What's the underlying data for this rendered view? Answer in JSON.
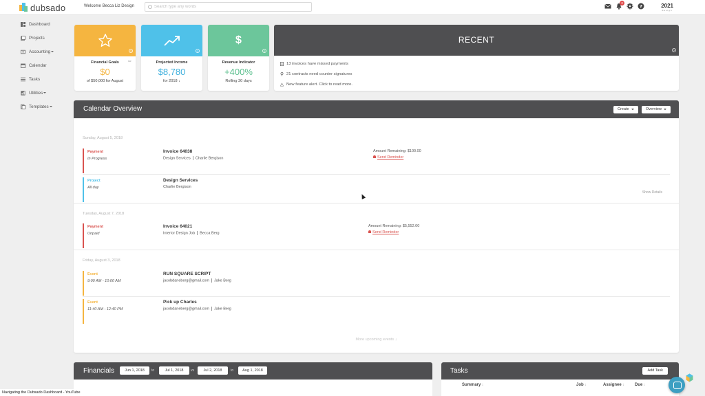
{
  "app": {
    "logo_text": "dubsado",
    "welcome": "Welcome Becca Liz Design",
    "search_placeholder": "Search type any words",
    "notification_count": "3",
    "brand_badge": "2021",
    "brand_badge_sub": "design"
  },
  "sidebar": {
    "items": [
      {
        "label": "Dashboard",
        "icon": "dashboard-icon"
      },
      {
        "label": "Projects",
        "icon": "projects-icon"
      },
      {
        "label": "Accounting",
        "icon": "accounting-icon",
        "has_dropdown": true
      },
      {
        "label": "Calendar",
        "icon": "calendar-icon"
      },
      {
        "label": "Tasks",
        "icon": "tasks-icon"
      },
      {
        "label": "Utilities",
        "icon": "utilities-icon",
        "has_dropdown": true
      },
      {
        "label": "Templates",
        "icon": "templates-icon",
        "has_dropdown": true
      }
    ]
  },
  "cards": [
    {
      "label": "Financial Goals",
      "value": "$0",
      "sub": "of $50,000 for August",
      "color": "#f5b540",
      "icon": "star-icon",
      "value_color": "#f5b540"
    },
    {
      "label": "Projected Income",
      "value": "$8,780",
      "sub": "for 2018 ↓",
      "color": "#4fc1e9",
      "icon": "trend-up-icon",
      "value_color": "#3fb0dd"
    },
    {
      "label": "Revenue Indicator",
      "value": "+400%",
      "sub": "Rolling 30 days",
      "color": "#6cc69b",
      "icon": "dollar-icon",
      "value_color": "#5cbf8e"
    }
  ],
  "recent": {
    "title": "RECENT",
    "items": [
      {
        "text": "13 invoices have missed payments",
        "icon": "invoice-icon"
      },
      {
        "text": "21 contracts need counter signatures",
        "icon": "pin-icon"
      },
      {
        "text": "New feature alert. Click to read more.",
        "icon": "warning-icon"
      }
    ]
  },
  "calendar": {
    "title": "Calendar Overview",
    "create_label": "Create",
    "overview_label": "Overview",
    "dates": [
      "Sunday, August 5, 2018",
      "Tuesday, August 7, 2018",
      "Friday, August 3, 2018"
    ],
    "events": [
      {
        "type": "Payment",
        "status": "In Progress",
        "title": "Invoice 64038",
        "meta_a": "Design Services",
        "meta_b": "Charlie Bergison",
        "amount": "Amount Remaining: $100.00",
        "reminder": "Send Reminder",
        "color": "#d9534f"
      },
      {
        "type": "Project",
        "status": "All day",
        "title": "Design Services",
        "meta_a": "Charlie Bergison",
        "show_details": "Show Details",
        "color": "#4fc1e9"
      },
      {
        "type": "Payment",
        "status": "Unpaid",
        "title": "Invoice 64021",
        "meta_a": "Interior Design Job",
        "meta_b": "Becca Berg",
        "amount": "Amount Remaining: $5,552.00",
        "reminder": "Send Reminder",
        "color": "#d9534f"
      },
      {
        "type": "Event",
        "status": "9:00 AM - 10:00 AM",
        "title": "RUN SQUARE SCRIPT",
        "meta_a": "jacobdaneberg@gmail.com",
        "meta_b": "Jake Berg",
        "color": "#f5b540"
      },
      {
        "type": "Event",
        "status": "11:40 AM - 12:40 PM",
        "title": "Pick up Charles",
        "meta_a": "jacobdaneberg@gmail.com",
        "meta_b": "Jake Berg",
        "color": "#f5b540"
      }
    ],
    "more_upcoming": "More upcoming events ↓"
  },
  "financials": {
    "title": "Financials",
    "range_a_start": "Jun 1, 2018",
    "range_a_to": "to",
    "range_a_end": "Jul 1, 2018",
    "vs": "vs",
    "range_b_start": "Jul 2, 2018",
    "range_b_to": "to",
    "range_b_end": "Aug 1, 2018"
  },
  "tasks": {
    "title": "Tasks",
    "add_label": "Add Task",
    "columns": [
      "Summary",
      "Job",
      "Assignee",
      "Due"
    ]
  },
  "video_caption": "Navigating the Dubsado Dashboard - YouTube"
}
